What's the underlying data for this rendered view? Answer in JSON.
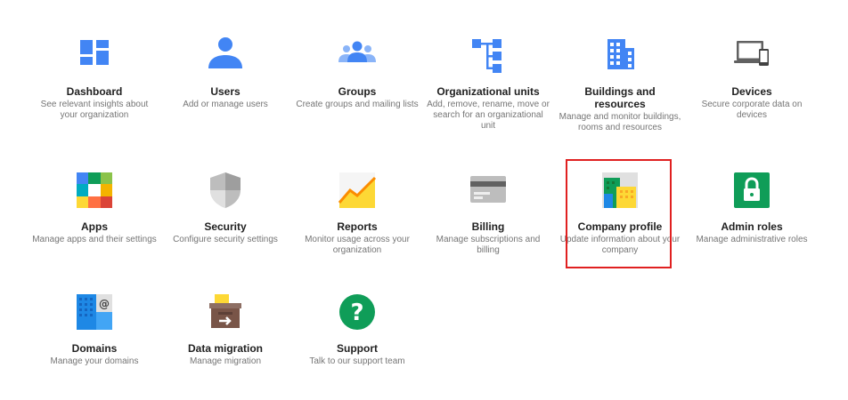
{
  "tiles": [
    {
      "name": "dashboard",
      "title": "Dashboard",
      "desc": "See relevant insights about your organization"
    },
    {
      "name": "users",
      "title": "Users",
      "desc": "Add or manage users"
    },
    {
      "name": "groups",
      "title": "Groups",
      "desc": "Create groups and mailing lists"
    },
    {
      "name": "org-units",
      "title": "Organizational units",
      "desc": "Add, remove, rename, move or search for an organizational unit"
    },
    {
      "name": "buildings",
      "title": "Buildings and resources",
      "desc": "Manage and monitor buildings, rooms and resources"
    },
    {
      "name": "devices",
      "title": "Devices",
      "desc": "Secure corporate data on devices"
    },
    {
      "name": "apps",
      "title": "Apps",
      "desc": "Manage apps and their settings"
    },
    {
      "name": "security",
      "title": "Security",
      "desc": "Configure security settings"
    },
    {
      "name": "reports",
      "title": "Reports",
      "desc": "Monitor usage across your organization"
    },
    {
      "name": "billing",
      "title": "Billing",
      "desc": "Manage subscriptions and billing"
    },
    {
      "name": "company-profile",
      "title": "Company profile",
      "desc": "Update information about your company"
    },
    {
      "name": "admin-roles",
      "title": "Admin roles",
      "desc": "Manage administrative roles"
    },
    {
      "name": "domains",
      "title": "Domains",
      "desc": "Manage your domains"
    },
    {
      "name": "data-migration",
      "title": "Data migration",
      "desc": "Manage migration"
    },
    {
      "name": "support",
      "title": "Support",
      "desc": "Talk to our support team"
    }
  ],
  "icons": [
    "dashboard-icon",
    "users-icon",
    "groups-icon",
    "org-units-icon",
    "buildings-icon",
    "devices-icon",
    "apps-icon",
    "security-icon",
    "reports-icon",
    "billing-icon",
    "company-profile-icon",
    "admin-roles-icon",
    "domains-icon",
    "data-migration-icon",
    "support-icon"
  ],
  "colors": {
    "highlight": "#e02020",
    "blue": "#4285f4",
    "green": "#0f9d58",
    "yellow": "#f4b400",
    "red": "#db4437"
  }
}
